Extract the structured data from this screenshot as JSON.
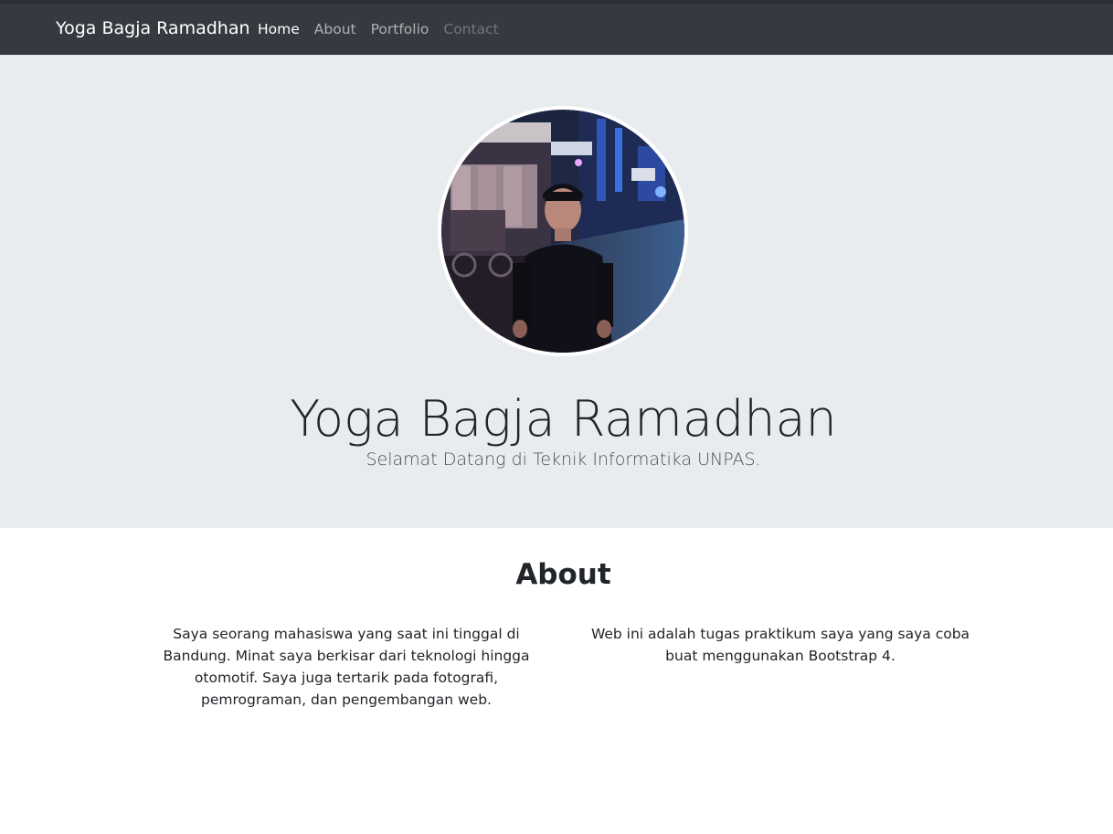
{
  "navbar": {
    "brand": "Yoga Bagja Ramadhan",
    "items": [
      {
        "label": "Home",
        "state": "active"
      },
      {
        "label": "About",
        "state": "normal"
      },
      {
        "label": "Portfolio",
        "state": "normal"
      },
      {
        "label": "Contact",
        "state": "disabled"
      }
    ]
  },
  "hero": {
    "image_alt": "profile-photo",
    "name": "Yoga Bagja Ramadhan",
    "tagline": "Selamat Datang di Teknik Informatika UNPAS."
  },
  "about": {
    "title": "About",
    "left_text": "Saya seorang mahasiswa yang saat ini tinggal di Bandung. Minat saya berkisar dari teknologi hingga otomotif. Saya juga tertarik pada fotografi, pemrograman, dan pengembangan web.",
    "right_text": "Web ini adalah tugas praktikum saya yang saya coba buat menggunakan Bootstrap 4."
  },
  "colors": {
    "navbar_bg": "#343a40",
    "jumbotron_bg": "#e9ecef",
    "page_bg": "#ffffff"
  }
}
